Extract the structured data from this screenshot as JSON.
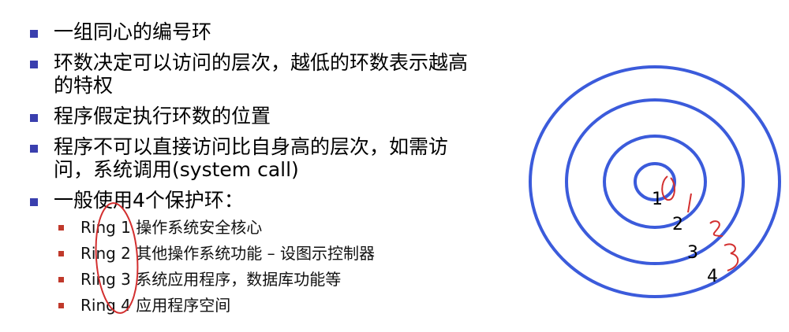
{
  "bullets": [
    "一组同心的编号环",
    "环数决定可以访问的层次，越低的环数表示越高的特权",
    "程序假定执行环数的位置",
    "程序不可以直接访问比自身高的层次，如需访问，系统调用(system call)",
    "一般使用4个保护环："
  ],
  "sub_bullets": [
    "Ring 1 操作系统安全核心",
    "Ring 2 其他操作系统功能 – 设图示控制器",
    "Ring 3 系统应用程序，数据库功能等",
    "Ring 4 应用程序空间"
  ],
  "diagram": {
    "ring_labels": [
      "1",
      "2",
      "3",
      "4"
    ],
    "ring_color": "#3b5bdb",
    "annotation_color": "#d32f2f",
    "annotation_marks": [
      "0",
      "1",
      "2",
      "3"
    ]
  },
  "colors": {
    "bullet_marker": "#3a3fae",
    "sub_bullet_marker": "#c0392b"
  }
}
